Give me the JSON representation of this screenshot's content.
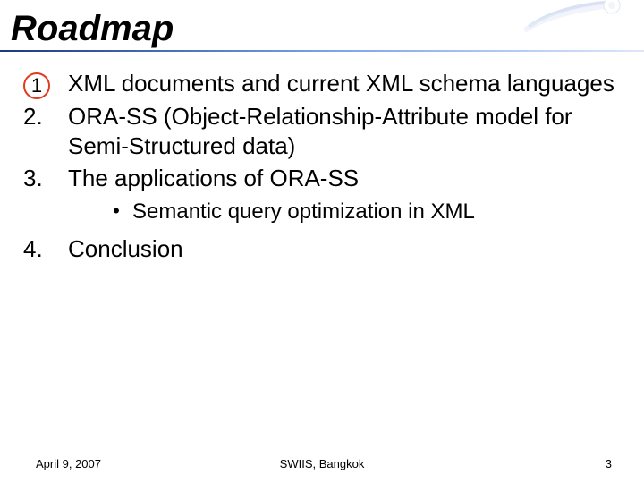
{
  "slide": {
    "title": "Roadmap",
    "items": [
      {
        "num": "1",
        "circled": true,
        "text": "XML documents and current XML schema languages"
      },
      {
        "num": "2.",
        "circled": false,
        "text": "ORA-SS (Object-Relationship-Attribute model for Semi-Structured data)"
      },
      {
        "num": "3.",
        "circled": false,
        "text": "The applications of ORA-SS"
      }
    ],
    "subitem": {
      "bullet": "•",
      "text": "Semantic query optimization in XML"
    },
    "item4": {
      "num": "4.",
      "text": "Conclusion"
    },
    "footer": {
      "date": "April 9, 2007",
      "venue": "SWIIS, Bangkok",
      "page": "3"
    }
  }
}
